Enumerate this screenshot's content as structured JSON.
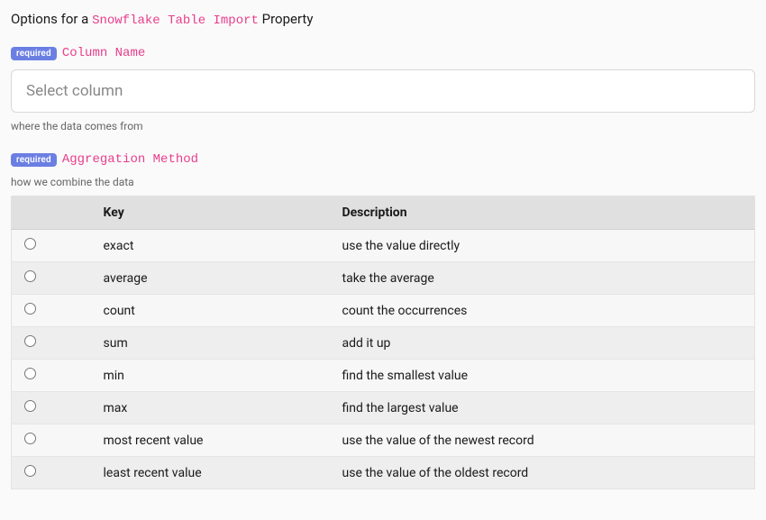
{
  "title": {
    "prefix": "Options for a",
    "code": "Snowflake Table Import",
    "suffix": "Property"
  },
  "badges": {
    "required": "required"
  },
  "columnName": {
    "label": "Column Name",
    "placeholder": "Select column",
    "help": "where the data comes from"
  },
  "aggregation": {
    "label": "Aggregation Method",
    "help": "how we combine the data",
    "columns": {
      "key": "Key",
      "description": "Description"
    },
    "options": [
      {
        "key": "exact",
        "description": "use the value directly"
      },
      {
        "key": "average",
        "description": "take the average"
      },
      {
        "key": "count",
        "description": "count the occurrences"
      },
      {
        "key": "sum",
        "description": "add it up"
      },
      {
        "key": "min",
        "description": "find the smallest value"
      },
      {
        "key": "max",
        "description": "find the largest value"
      },
      {
        "key": "most recent value",
        "description": "use the value of the newest record"
      },
      {
        "key": "least recent value",
        "description": "use the value of the oldest record"
      }
    ]
  }
}
